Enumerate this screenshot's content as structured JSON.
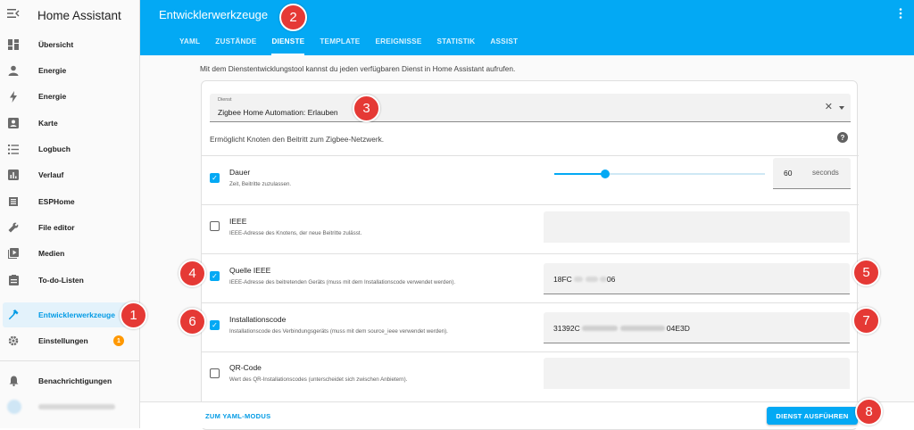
{
  "sidebar": {
    "title": "Home Assistant",
    "items": [
      {
        "label": "Übersicht",
        "icon": "dashboard-icon"
      },
      {
        "label": "Energie",
        "icon": "person-icon"
      },
      {
        "label": "Energie",
        "icon": "lightning-icon"
      },
      {
        "label": "Karte",
        "icon": "map-icon"
      },
      {
        "label": "Logbuch",
        "icon": "list-icon"
      },
      {
        "label": "Verlauf",
        "icon": "chart-icon"
      },
      {
        "label": "ESPHome",
        "icon": "esphome-icon"
      },
      {
        "label": "File editor",
        "icon": "wrench-icon"
      },
      {
        "label": "Medien",
        "icon": "media-icon"
      },
      {
        "label": "To-do-Listen",
        "icon": "clipboard-icon"
      },
      {
        "label": "Entwicklerwerkzeuge",
        "icon": "hammer-icon",
        "active": true
      },
      {
        "label": "Einstellungen",
        "icon": "gear-icon",
        "badge": "1"
      }
    ],
    "notifications": "Benachrichtigungen"
  },
  "header": {
    "title": "Entwicklerwerkzeuge",
    "tabs": [
      "YAML",
      "ZUSTÄNDE",
      "DIENSTE",
      "TEMPLATE",
      "EREIGNISSE",
      "STATISTIK",
      "ASSIST"
    ],
    "active_tab": "DIENSTE"
  },
  "main": {
    "intro": "Mit dem Dienstentwicklungstool kannst du jeden verfügbaren Dienst in Home Assistant aufrufen.",
    "service_label": "Dienst",
    "service_value": "Zigbee Home Automation: Erlauben",
    "service_description": "Ermöglicht Knoten den Beitritt zum Zigbee-Netzwerk.",
    "params": [
      {
        "name": "Dauer",
        "desc": "Zeit, Beitritte zuzulassen.",
        "checked": true,
        "value": "60",
        "unit": "seconds",
        "slider_fraction": 0.24
      },
      {
        "name": "IEEE",
        "desc": "IEEE-Adresse des Knotens, der neue Beitritte zulässt.",
        "checked": false,
        "value": ""
      },
      {
        "name": "Quelle IEEE",
        "desc": "IEEE-Adresse des beitretenden Geräts (muss mit dem Installationscode verwendet werden).",
        "checked": true,
        "value_start": "18FC",
        "value_end": "06"
      },
      {
        "name": "Installationscode",
        "desc": "Installationscode des Verbindungsgeräts (muss mit dem source_ieee verwendet werden).",
        "checked": true,
        "value_start": "31392C",
        "value_end": "04E3D"
      },
      {
        "name": "QR-Code",
        "desc": "Wert des QR-Installationscodes (unterscheidet sich zwischen Anbietern).",
        "checked": false,
        "value": ""
      }
    ]
  },
  "footer": {
    "yaml_mode": "ZUM YAML-MODUS",
    "run_button": "DIENST AUSFÜHREN"
  },
  "markers": [
    "1",
    "2",
    "3",
    "4",
    "5",
    "6",
    "7",
    "8"
  ],
  "colors": {
    "primary": "#03a9f4",
    "marker": "#e53935",
    "badge": "#ff9800"
  }
}
